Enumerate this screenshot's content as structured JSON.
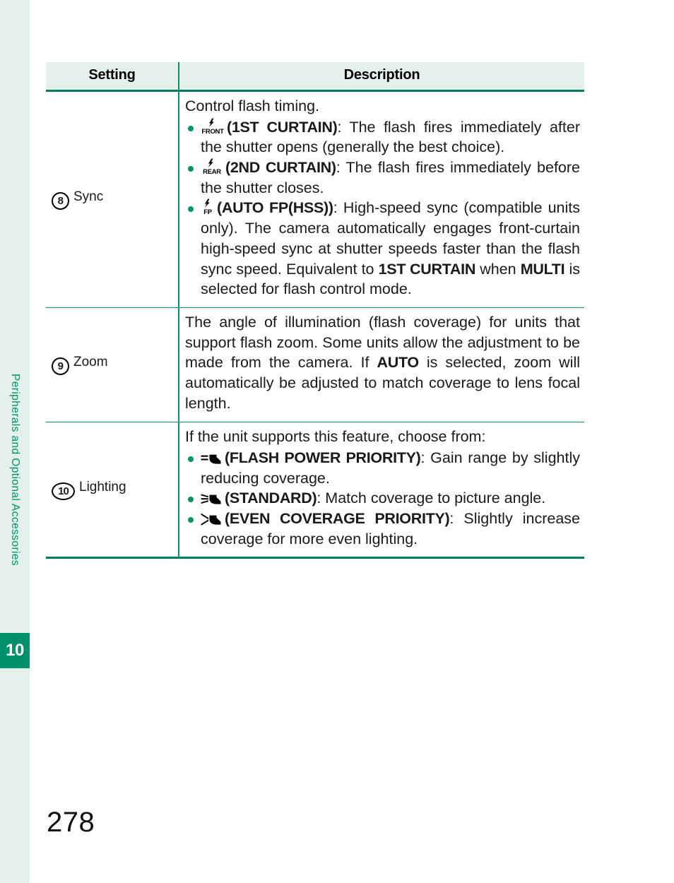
{
  "sidebar": {
    "chapter_title": "Peripherals and Optional Accessories",
    "chapter_number": "10",
    "accent_color": "#00916c",
    "tab_background": "#e4f1ea"
  },
  "page": {
    "number": "278"
  },
  "table": {
    "headers": {
      "setting": "Setting",
      "description": "Description"
    },
    "rows": [
      {
        "number": "8",
        "label": "Sync",
        "lead": "Control flash timing.",
        "bullets": [
          {
            "icon": "flash-front-icon",
            "icon_caption": "FRONT",
            "term": "(1ST CURTAIN)",
            "text": ": The flash fires immediately after the shutter opens (generally the best choice)."
          },
          {
            "icon": "flash-rear-icon",
            "icon_caption": "REAR",
            "term": "(2ND CURTAIN)",
            "text": ": The flash fires immediately before the shutter closes."
          },
          {
            "icon": "flash-fp-icon",
            "icon_caption": "FP",
            "term": "(AUTO FP(HSS))",
            "text_part1": ": High-speed sync (compatible units only). The camera automatically engages front-curtain high-speed sync at shutter speeds faster than the flash sync speed. Equivalent to ",
            "emphasis1": "1ST CURTAIN",
            "text_part2": " when ",
            "emphasis2": "MULTI",
            "text_part3": " is selected for flash control mode."
          }
        ]
      },
      {
        "number": "9",
        "label": "Zoom",
        "body_part1": "The angle of illumination (flash coverage) for units that support flash zoom. Some units allow the adjustment to be made from the camera. If ",
        "body_emphasis": "AUTO",
        "body_part2": " is selected, zoom will automatically be adjusted to match coverage to lens focal length."
      },
      {
        "number": "10",
        "label": "Lighting",
        "lead": "If the unit supports this feature, choose from:",
        "bullets": [
          {
            "icon": "beam-narrow-icon",
            "term": "(FLASH POWER PRIORITY)",
            "text": ": Gain range by slightly reducing coverage."
          },
          {
            "icon": "beam-standard-icon",
            "term": "(STANDARD)",
            "text": ": Match coverage to picture angle."
          },
          {
            "icon": "beam-wide-icon",
            "term": "(EVEN COVERAGE PRIORITY)",
            "text": ": Slightly increase coverage for more even lighting."
          }
        ]
      }
    ]
  }
}
